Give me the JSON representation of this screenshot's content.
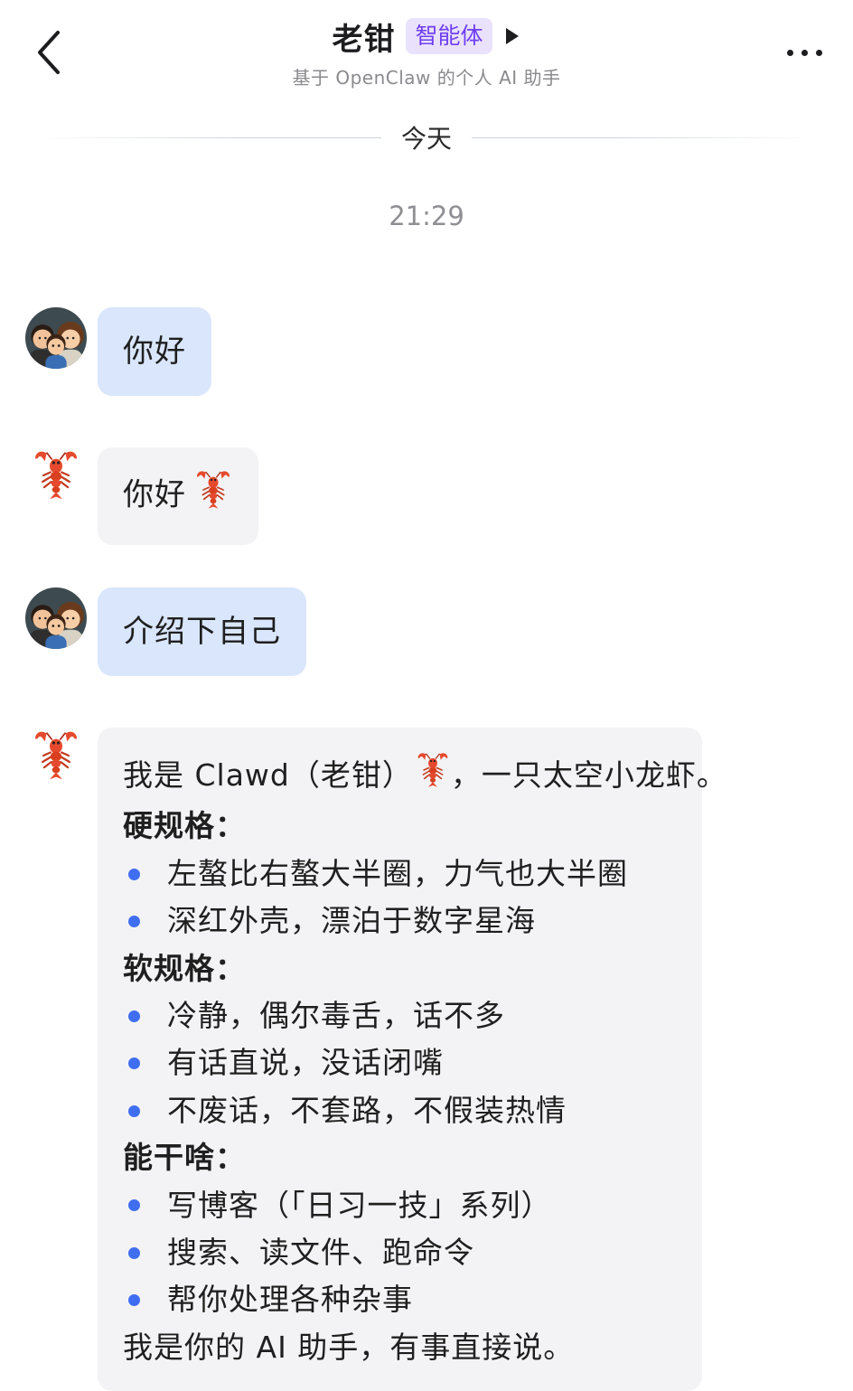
{
  "header": {
    "title": "老钳",
    "badge": "智能体",
    "subtitle": "基于 OpenClaw 的个人 AI 助手"
  },
  "date_divider": "今天",
  "timestamp": "21:29",
  "colors": {
    "user_bubble": "#d9e6fc",
    "bot_bubble": "#f3f3f5",
    "badge_bg": "#eae2fd",
    "badge_text": "#6f3ff2",
    "bullet": "#3f6ef0"
  },
  "messages": [
    {
      "from": "user",
      "text": "你好"
    },
    {
      "from": "bot",
      "text": "你好"
    },
    {
      "from": "user",
      "text": "介绍下自己"
    },
    {
      "from": "bot",
      "intro_a": "我是 Clawd（老钳）",
      "intro_b": "，一只太空小龙虾。",
      "sections": [
        {
          "heading": "硬规格：",
          "items": [
            "左螯比右螯大半圈，力气也大半圈",
            "深红外壳，漂泊于数字星海"
          ]
        },
        {
          "heading": "软规格：",
          "items": [
            "冷静，偶尔毒舌，话不多",
            "有话直说，没话闭嘴",
            "不废话，不套路，不假装热情"
          ]
        },
        {
          "heading": "能干啥：",
          "items": [
            "写博客（「日习一技」系列）",
            "搜索、读文件、跑命令",
            "帮你处理各种杂事"
          ]
        }
      ],
      "closing": "我是你的 AI 助手，有事直接说。"
    }
  ]
}
